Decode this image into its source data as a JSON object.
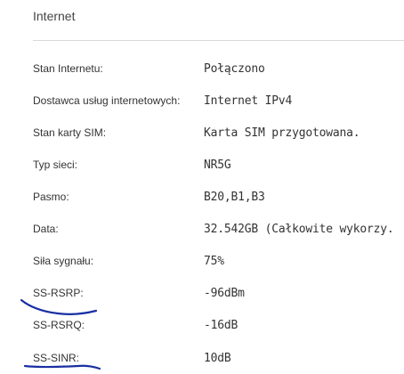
{
  "section": {
    "title": "Internet"
  },
  "rows": [
    {
      "label": "Stan Internetu:",
      "value": "Połączono"
    },
    {
      "label": "Dostawca usług internetowych:",
      "value": "Internet IPv4"
    },
    {
      "label": "Stan karty SIM:",
      "value": "Karta SIM przygotowana."
    },
    {
      "label": "Typ sieci:",
      "value": "NR5G"
    },
    {
      "label": "Pasmo:",
      "value": "B20,B1,B3"
    },
    {
      "label": "Data:",
      "value": "32.542GB (Całkowite wykorzy..."
    },
    {
      "label": "Siła sygnału:",
      "value": "75%"
    },
    {
      "label": "SS-RSRP:",
      "value": "-96dBm"
    },
    {
      "label": "SS-RSRQ:",
      "value": "-16dB"
    },
    {
      "label": "SS-SINR:",
      "value": "10dB"
    }
  ],
  "colors": {
    "annotation_pen": "#1a2fa3",
    "text": "#333333",
    "divider": "#d9d9d9"
  }
}
